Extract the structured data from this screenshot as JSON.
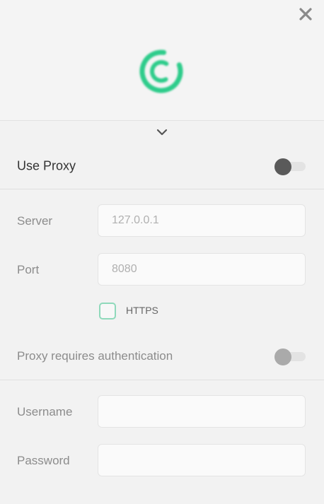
{
  "window": {
    "close_icon": "close-icon",
    "logo_icon": "spinner-logo-icon"
  },
  "panel": {
    "collapse_icon": "chevron-down-icon"
  },
  "use_proxy": {
    "label": "Use Proxy",
    "enabled": false,
    "knob_color": "#5a5a5a"
  },
  "server": {
    "label": "Server",
    "placeholder": "127.0.0.1",
    "value": ""
  },
  "port": {
    "label": "Port",
    "placeholder": "8080",
    "value": ""
  },
  "https": {
    "label": "HTTPS",
    "checked": false,
    "border_color": "#8fd9bb"
  },
  "auth": {
    "label": "Proxy requires authentication",
    "enabled": false,
    "knob_color": "#aaaaaa"
  },
  "username": {
    "label": "Username",
    "value": ""
  },
  "password": {
    "label": "Password",
    "value": ""
  },
  "colors": {
    "accent": "#2ecc8b",
    "background": "#f4f4f4"
  }
}
